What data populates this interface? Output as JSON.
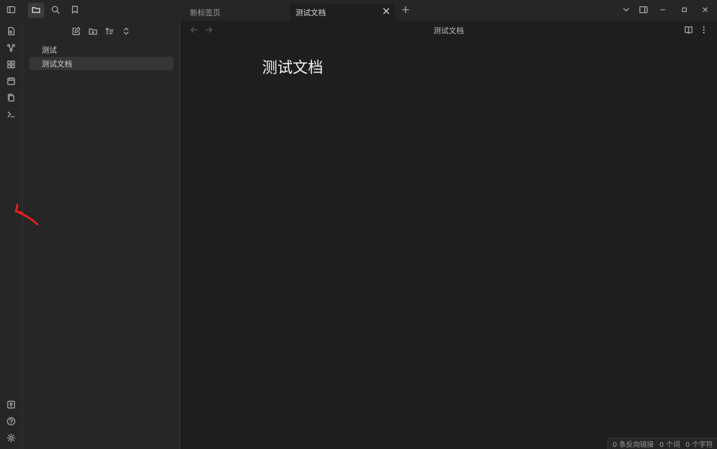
{
  "tabs": [
    {
      "label": "新标签页",
      "active": false
    },
    {
      "label": "测试文档",
      "active": true
    }
  ],
  "sidebar": {
    "files": [
      {
        "label": "测试",
        "selected": false
      },
      {
        "label": "测试文档",
        "selected": true
      }
    ]
  },
  "editor": {
    "view_title": "测试文档",
    "doc_title": "测试文档"
  },
  "status_bar": {
    "backlinks": "0 条反向链接",
    "words": "0 个词",
    "chars": "0 个字符"
  },
  "colors": {
    "annotation_arrow": "#e02020",
    "background": "#1e1e1e",
    "panel": "#262626"
  },
  "icons": [
    "sidebar-toggle-icon",
    "folder-icon",
    "search-icon",
    "bookmark-icon",
    "new-tab-icon",
    "chevron-down-icon",
    "layout-icon",
    "minimize-icon",
    "maximize-icon",
    "close-icon",
    "open-quick-switcher-icon",
    "graph-icon",
    "canvas-icon",
    "calendar-icon",
    "templates-icon",
    "terminal-icon",
    "vault-icon",
    "help-icon",
    "settings-icon",
    "new-note-icon",
    "new-folder-icon",
    "sort-icon",
    "collapse-icon",
    "back-arrow-icon",
    "forward-arrow-icon",
    "reading-view-icon",
    "more-options-icon"
  ]
}
